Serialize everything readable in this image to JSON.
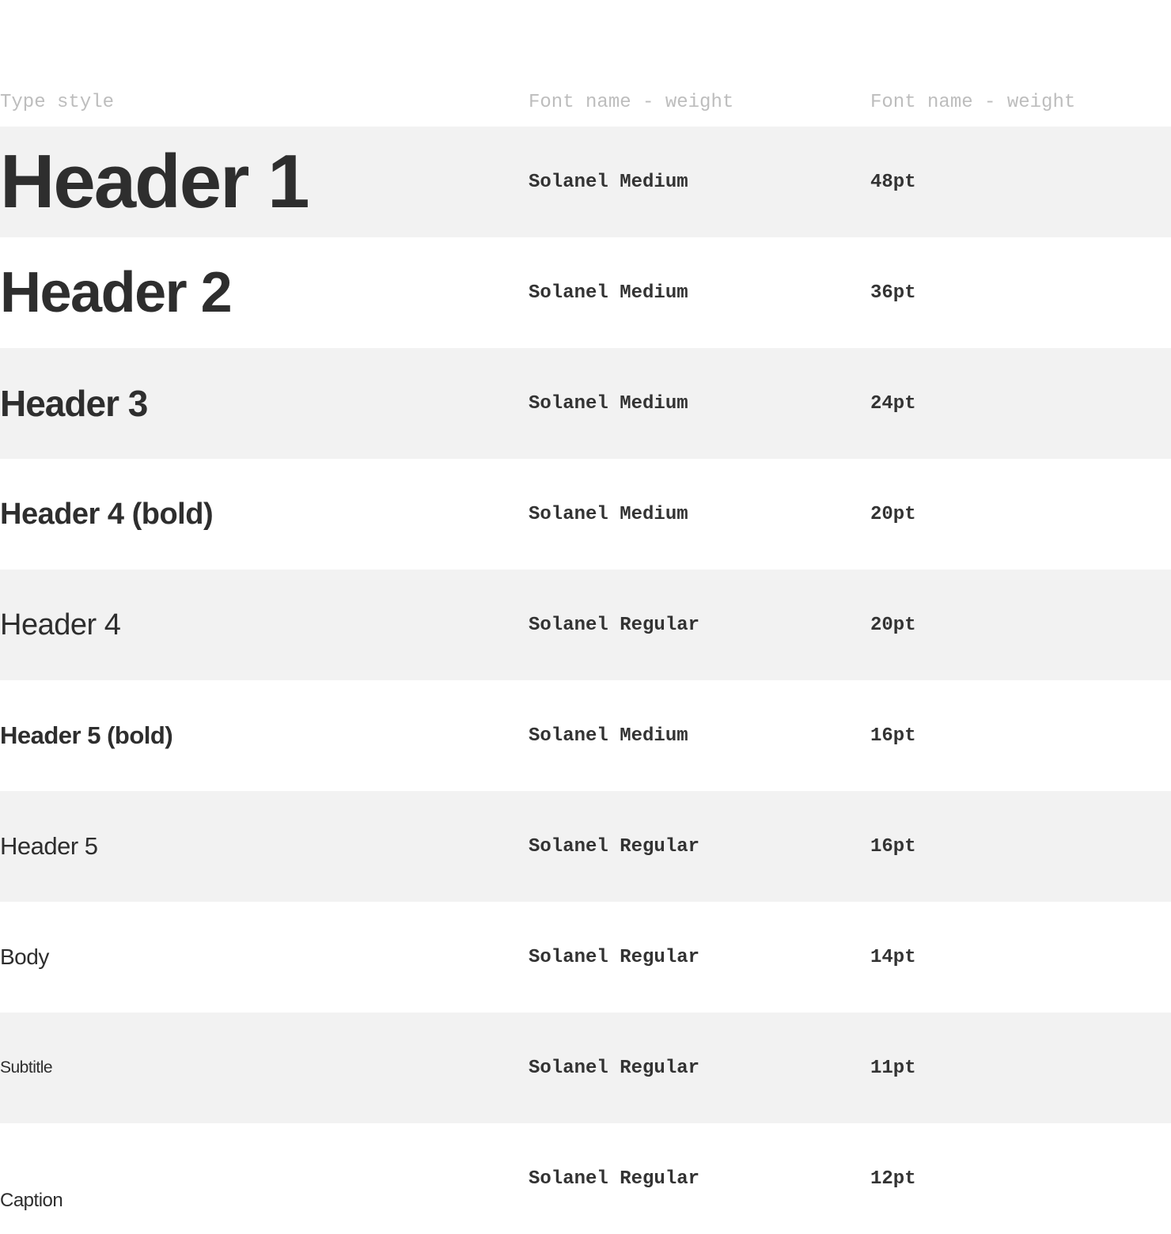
{
  "columns": [
    "Type style",
    "Font name - weight",
    "Font name - weight"
  ],
  "rows": [
    {
      "style": "Header 1",
      "font": "Solanel Medium",
      "size": "48pt"
    },
    {
      "style": "Header 2",
      "font": "Solanel Medium",
      "size": "36pt"
    },
    {
      "style": "Header 3",
      "font": "Solanel Medium",
      "size": "24pt"
    },
    {
      "style": "Header 4 (bold)",
      "font": "Solanel Medium",
      "size": "20pt"
    },
    {
      "style": "Header 4",
      "font": "Solanel Regular",
      "size": "20pt"
    },
    {
      "style": "Header 5 (bold)",
      "font": "Solanel Medium",
      "size": "16pt"
    },
    {
      "style": "Header 5",
      "font": "Solanel Regular",
      "size": "16pt"
    },
    {
      "style": "Body",
      "font": "Solanel Regular",
      "size": "14pt"
    },
    {
      "style": "Subtitle",
      "font": "Solanel Regular",
      "size": "11pt"
    },
    {
      "style": "Caption",
      "font": "Solanel Regular",
      "size": "12pt"
    }
  ]
}
